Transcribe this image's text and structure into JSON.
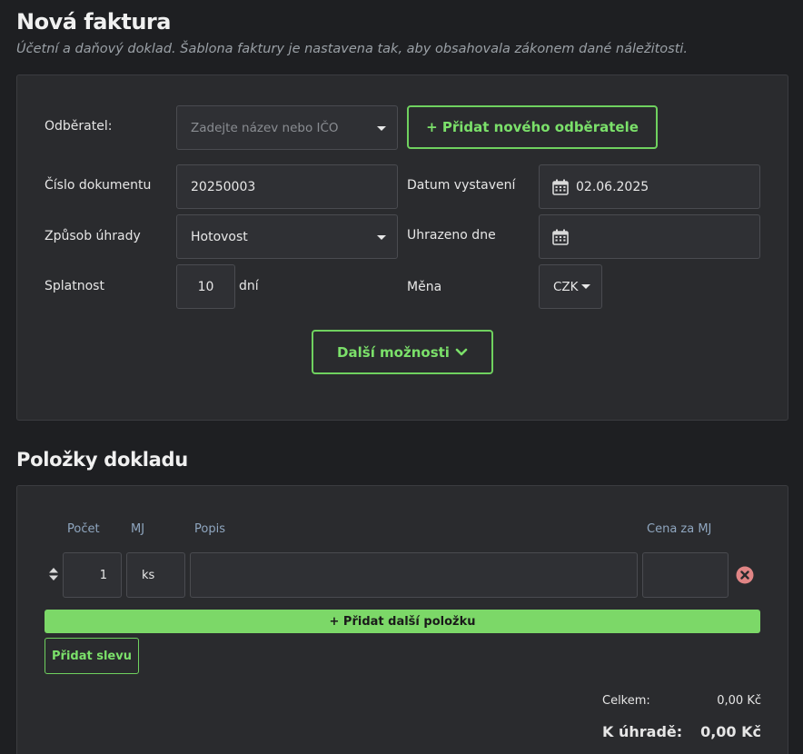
{
  "page": {
    "title": "Nová faktura",
    "subtitle": "Účetní a daňový doklad. Šablona faktury je nastavena tak, aby obsahovala zákonem dané náležitosti."
  },
  "form": {
    "customer_label": "Odběratel:",
    "customer_placeholder": "Zadejte název nebo IČO",
    "add_customer_button": "+ Přidat nového odběratele",
    "doc_number_label": "Číslo dokumentu",
    "doc_number_value": "20250003",
    "issue_date_label": "Datum vystavení",
    "issue_date_value": "02.06.2025",
    "payment_method_label": "Způsob úhrady",
    "payment_method_value": "Hotovost",
    "paid_date_label": "Uhrazeno dne",
    "paid_date_value": "",
    "due_label": "Splatnost",
    "due_value": "10",
    "due_unit": "dní",
    "currency_label": "Měna",
    "currency_value": "CZK",
    "more_options_button": "Další možnosti"
  },
  "items": {
    "section_title": "Položky dokladu",
    "columns": {
      "count": "Počet",
      "unit": "MJ",
      "description": "Popis",
      "unit_price": "Cena za MJ"
    },
    "rows": [
      {
        "count": "1",
        "unit": "ks",
        "description": "",
        "unit_price": ""
      }
    ],
    "add_item_button": "+ Přidat další položku",
    "add_discount_button": "Přidat slevu"
  },
  "totals": {
    "total_label": "Celkem:",
    "total_value": "0,00 Kč",
    "to_pay_label": "K úhradě:",
    "to_pay_value": "0,00 Kč"
  },
  "colors": {
    "accent": "#6fd15f",
    "background": "#1e1f22",
    "panel": "#2a2b2e",
    "remove": "#e08585"
  }
}
